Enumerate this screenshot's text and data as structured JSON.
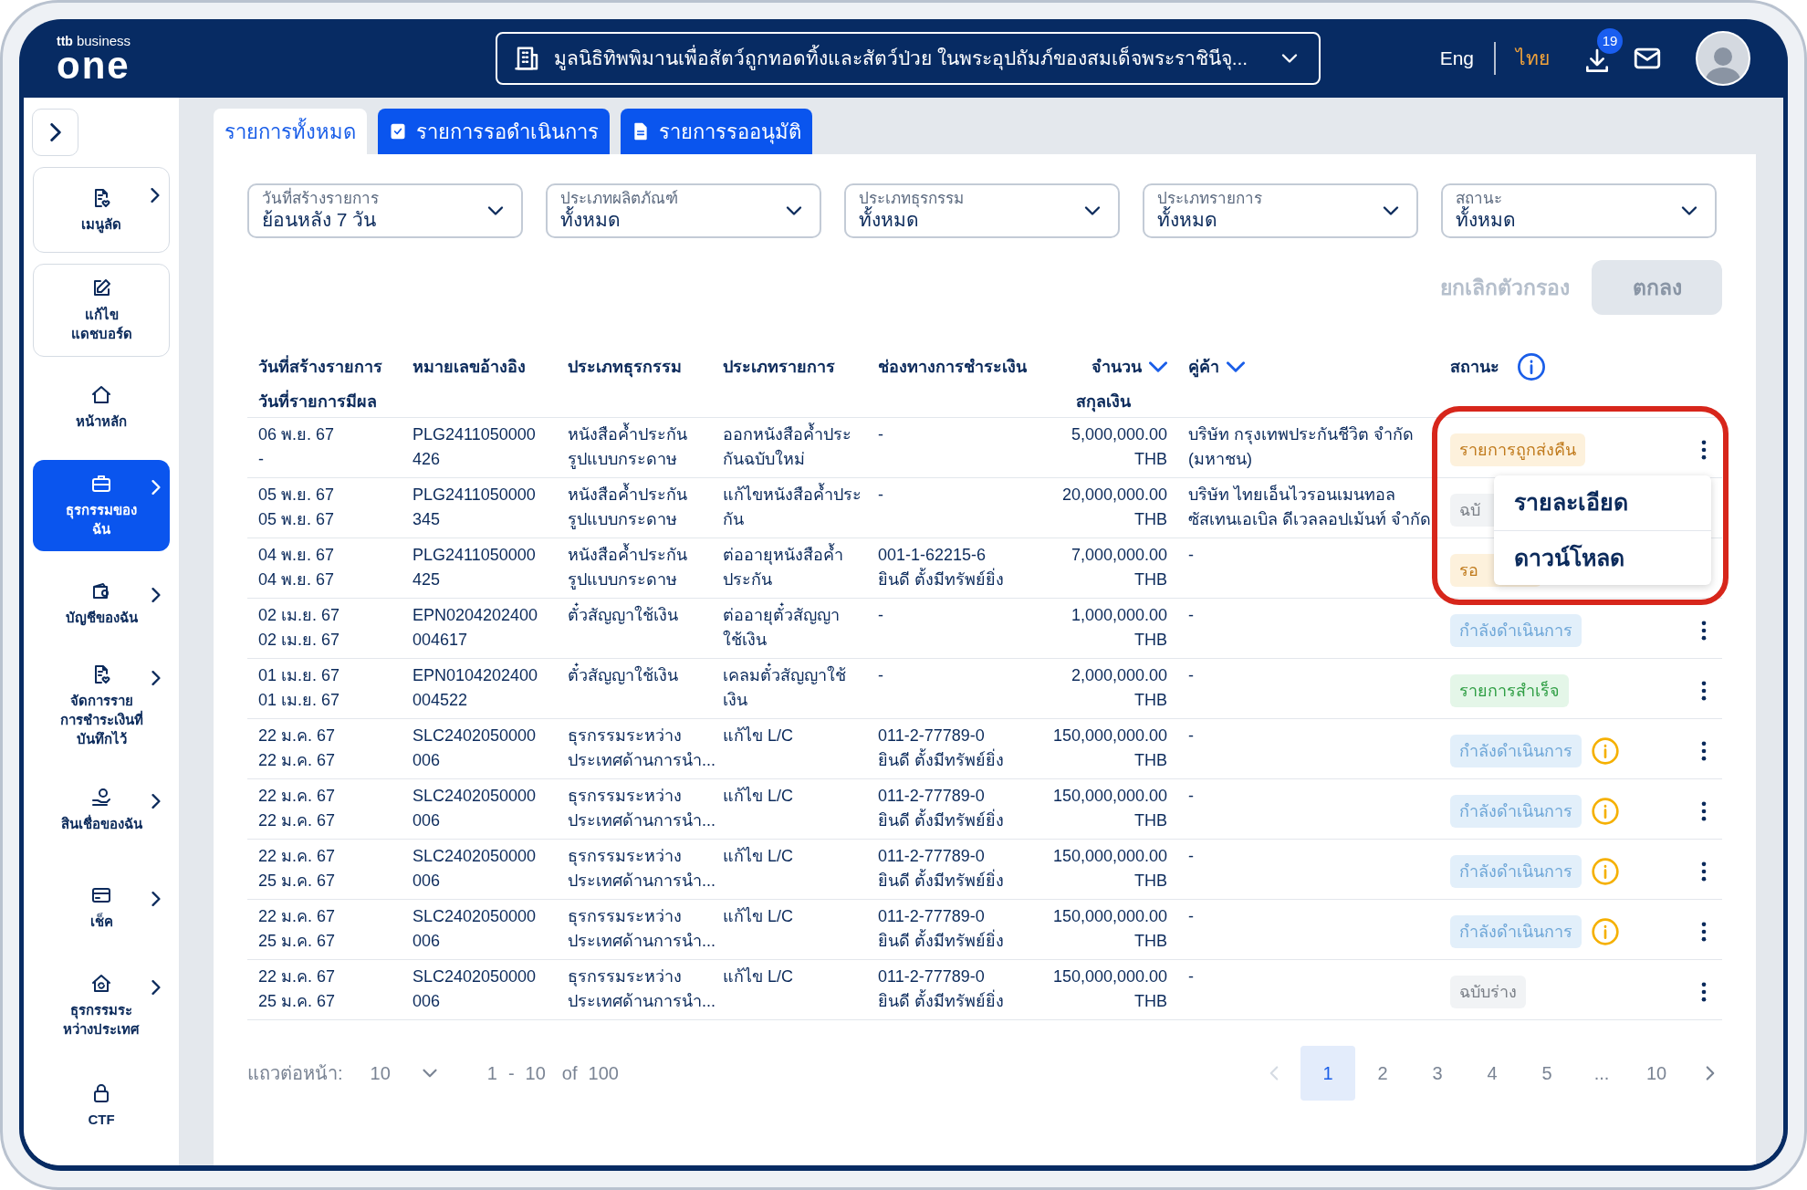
{
  "header": {
    "logo": {
      "brand": "ttb",
      "product": "business",
      "name": "one"
    },
    "org_selector": {
      "value": "มูลนิธิทิพพิมานเพื่อสัตว์ถูกทอดทิ้งและสัตว์ป่วย ในพระอุปถัมภ์ของสมเด็จพระราชินีจุ..."
    },
    "languages": [
      {
        "label": "Eng",
        "selected": false
      },
      {
        "label": "ไทย",
        "selected": true
      }
    ],
    "download_badge": "19"
  },
  "sidebar": {
    "items": [
      {
        "label": "เมนูลัด",
        "kind": "card",
        "expandable": true,
        "selected": false
      },
      {
        "label": "แก้ไข\nแดชบอร์ด",
        "kind": "card",
        "expandable": false,
        "selected": false
      },
      {
        "label": "หน้าหลัก",
        "kind": "plain",
        "expandable": false,
        "selected": false
      },
      {
        "label": "ธุรกรรมของ\nฉัน",
        "kind": "plain",
        "expandable": true,
        "selected": true
      },
      {
        "label": "บัญชีของฉัน",
        "kind": "plain",
        "expandable": true,
        "selected": false
      },
      {
        "label": "จัดการราย\nการชำระเงินที่\nบันทึกไว้",
        "kind": "plain",
        "expandable": true,
        "selected": false
      },
      {
        "label": "สินเชื่อของฉัน",
        "kind": "plain",
        "expandable": true,
        "selected": false
      },
      {
        "label": "เช็ค",
        "kind": "plain",
        "expandable": true,
        "selected": false
      },
      {
        "label": "ธุรกรรมระ\nหว่างประเทศ",
        "kind": "plain",
        "expandable": true,
        "selected": false
      },
      {
        "label": "CTF",
        "kind": "plain",
        "expandable": false,
        "selected": false
      }
    ]
  },
  "tabs": [
    {
      "label": "รายการทั้งหมด",
      "selected": true
    },
    {
      "label": "รายการรอดำเนินการ",
      "selected": false
    },
    {
      "label": "รายการรออนุมัติ",
      "selected": false
    }
  ],
  "filters": [
    {
      "label": "วันที่สร้างรายการ",
      "value": "ย้อนหลัง 7 วัน"
    },
    {
      "label": "ประเภทผลิตภัณฑ์",
      "value": "ทั้งหมด"
    },
    {
      "label": "ประเภทธุรกรรม",
      "value": "ทั้งหมด"
    },
    {
      "label": "ประเภทรายการ",
      "value": "ทั้งหมด"
    },
    {
      "label": "สถานะ",
      "value": "ทั้งหมด"
    }
  ],
  "filter_actions": {
    "clear": "ยกเลิกตัวกรอง",
    "apply": "ตกลง",
    "apply_disabled": true
  },
  "table": {
    "columns": [
      {
        "label": "วันที่สร้างรายการ",
        "sub_label": "วันที่รายการมีผล"
      },
      {
        "label": "หมายเลขอ้างอิง"
      },
      {
        "label": "ประเภทธุรกรรม"
      },
      {
        "label": "ประเภทรายการ"
      },
      {
        "label": "ช่องทางการชำระเงิน"
      },
      {
        "label": "จำนวน",
        "sub_label": "สกุลเงิน",
        "dropdown": true
      },
      {
        "label": "คู่ค้า",
        "dropdown": true
      },
      {
        "label": "สถานะ",
        "info": true
      }
    ],
    "rows": [
      {
        "created": "06 พ.ย. 67",
        "effective": "-",
        "reference": [
          "PLG2411050000",
          "426"
        ],
        "transaction_type": [
          "หนังสือค้ำประกัน",
          "รูปแบบกระดาษ"
        ],
        "item_type": [
          "ออกหนังสือค้ำประ",
          "กันฉบับใหม่"
        ],
        "channel": [
          "-"
        ],
        "amount": "5,000,000.00",
        "currency": "THB",
        "counterparty": [
          "บริษัท กรุงเทพประกันชีวิต จำกัด",
          "(มหาชน)"
        ],
        "status": {
          "label": "รายการถูกส่งคืน",
          "kind": "returned",
          "warning": false
        }
      },
      {
        "created": "05 พ.ย. 67",
        "effective": "05 พ.ย. 67",
        "reference": [
          "PLG2411050000",
          "345"
        ],
        "transaction_type": [
          "หนังสือค้ำประกัน",
          "รูปแบบกระดาษ"
        ],
        "item_type": [
          "แก้ไขหนังสือค้ำประ",
          "กัน"
        ],
        "channel": [
          "-"
        ],
        "amount": "20,000,000.00",
        "currency": "THB",
        "counterparty": [
          "บริษัท ไทยเอ็นไวรอนเมนทอล",
          "ซัสเทนเอเบิล ดีเวลลอปเม้นท์ จำกัด"
        ],
        "status": {
          "label": "ฉบั",
          "kind": "draft",
          "warning": false
        }
      },
      {
        "created": "04 พ.ย. 67",
        "effective": "04 พ.ย. 67",
        "reference": [
          "PLG2411050000",
          "425"
        ],
        "transaction_type": [
          "หนังสือค้ำประกัน",
          "รูปแบบกระดาษ"
        ],
        "item_type": [
          "ต่ออายุหนังสือค้ำ",
          "ประกัน"
        ],
        "channel": [
          "001-1-62215-6",
          "ยินดี ตั้งมีทรัพย์ยิ่ง"
        ],
        "amount": "7,000,000.00",
        "currency": "THB",
        "counterparty": [
          "-"
        ],
        "status": {
          "label": "รอ",
          "kind": "pending",
          "warning": false
        }
      },
      {
        "created": "02 เม.ย. 67",
        "effective": "02 เม.ย. 67",
        "reference": [
          "EPN0204202400",
          "004617"
        ],
        "transaction_type": [
          "ตั๋วสัญญาใช้เงิน"
        ],
        "item_type": [
          "ต่ออายุตั๋วสัญญา",
          "ใช้เงิน"
        ],
        "channel": [
          "-"
        ],
        "amount": "1,000,000.00",
        "currency": "THB",
        "counterparty": [
          "-"
        ],
        "status": {
          "label": "กำลังดำเนินการ",
          "kind": "processing",
          "warning": false
        }
      },
      {
        "created": "01 เม.ย. 67",
        "effective": "01 เม.ย. 67",
        "reference": [
          "EPN0104202400",
          "004522"
        ],
        "transaction_type": [
          "ตั๋วสัญญาใช้เงิน"
        ],
        "item_type": [
          "เคลมตั๋วสัญญาใช้",
          "เงิน"
        ],
        "channel": [
          "-"
        ],
        "amount": "2,000,000.00",
        "currency": "THB",
        "counterparty": [
          "-"
        ],
        "status": {
          "label": "รายการสำเร็จ",
          "kind": "success",
          "warning": false
        }
      },
      {
        "created": "22 ม.ค. 67",
        "effective": "22 ม.ค. 67",
        "reference": [
          "SLC2402050000",
          "006"
        ],
        "transaction_type": [
          "ธุรกรรมระหว่าง",
          "ประเทศด้านการนำ..."
        ],
        "item_type": [
          "แก้ไข L/C"
        ],
        "channel": [
          "011-2-77789-0",
          "ยินดี ตั้งมีทรัพย์ยิ่ง"
        ],
        "amount": "150,000,000.00",
        "currency": "THB",
        "counterparty": [
          "-"
        ],
        "status": {
          "label": "กำลังดำเนินการ",
          "kind": "processing",
          "warning": true
        }
      },
      {
        "created": "22 ม.ค. 67",
        "effective": "22 ม.ค. 67",
        "reference": [
          "SLC2402050000",
          "006"
        ],
        "transaction_type": [
          "ธุรกรรมระหว่าง",
          "ประเทศด้านการนำ..."
        ],
        "item_type": [
          "แก้ไข L/C"
        ],
        "channel": [
          "011-2-77789-0",
          "ยินดี ตั้งมีทรัพย์ยิ่ง"
        ],
        "amount": "150,000,000.00",
        "currency": "THB",
        "counterparty": [
          "-"
        ],
        "status": {
          "label": "กำลังดำเนินการ",
          "kind": "processing",
          "warning": true
        }
      },
      {
        "created": "22 ม.ค. 67",
        "effective": "25 ม.ค. 67",
        "reference": [
          "SLC2402050000",
          "006"
        ],
        "transaction_type": [
          "ธุรกรรมระหว่าง",
          "ประเทศด้านการนำ..."
        ],
        "item_type": [
          "แก้ไข L/C"
        ],
        "channel": [
          "011-2-77789-0",
          "ยินดี ตั้งมีทรัพย์ยิ่ง"
        ],
        "amount": "150,000,000.00",
        "currency": "THB",
        "counterparty": [
          "-"
        ],
        "status": {
          "label": "กำลังดำเนินการ",
          "kind": "processing",
          "warning": true
        }
      },
      {
        "created": "22 ม.ค. 67",
        "effective": "25 ม.ค. 67",
        "reference": [
          "SLC2402050000",
          "006"
        ],
        "transaction_type": [
          "ธุรกรรมระหว่าง",
          "ประเทศด้านการนำ..."
        ],
        "item_type": [
          "แก้ไข L/C"
        ],
        "channel": [
          "011-2-77789-0",
          "ยินดี ตั้งมีทรัพย์ยิ่ง"
        ],
        "amount": "150,000,000.00",
        "currency": "THB",
        "counterparty": [
          "-"
        ],
        "status": {
          "label": "กำลังดำเนินการ",
          "kind": "processing",
          "warning": true
        }
      },
      {
        "created": "22 ม.ค. 67",
        "effective": "25 ม.ค. 67",
        "reference": [
          "SLC2402050000",
          "006"
        ],
        "transaction_type": [
          "ธุรกรรมระหว่าง",
          "ประเทศด้านการนำ..."
        ],
        "item_type": [
          "แก้ไข L/C"
        ],
        "channel": [
          "011-2-77789-0",
          "ยินดี ตั้งมีทรัพย์ยิ่ง"
        ],
        "amount": "150,000,000.00",
        "currency": "THB",
        "counterparty": [
          "-"
        ],
        "status": {
          "label": "ฉบับร่าง",
          "kind": "draft",
          "warning": false
        }
      }
    ],
    "context_menu": {
      "items": [
        "รายละเอียด",
        "ดาวน์โหลด"
      ]
    }
  },
  "pagination": {
    "rows_per_page_label": "แถวต่อหน้า:",
    "rows_per_page": "10",
    "range_start": "1",
    "range_sep": "-",
    "range_end": "10",
    "of": "of",
    "total": "100",
    "pages": [
      {
        "label": "1",
        "selected": true
      },
      {
        "label": "2",
        "selected": false
      },
      {
        "label": "3",
        "selected": false
      },
      {
        "label": "4",
        "selected": false
      },
      {
        "label": "5",
        "selected": false
      },
      {
        "label": "...",
        "selected": false
      },
      {
        "label": "10",
        "selected": false
      }
    ],
    "prev_disabled": true
  }
}
